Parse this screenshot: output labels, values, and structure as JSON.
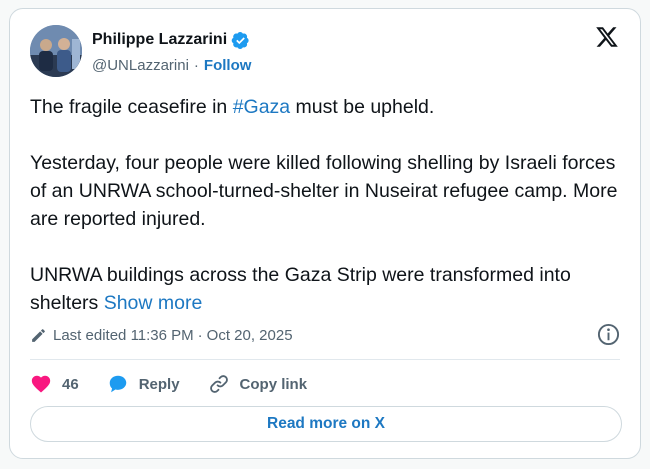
{
  "author": {
    "name": "Philippe Lazzarini",
    "handle": "@UNLazzarini",
    "separator": "·",
    "follow_label": "Follow"
  },
  "tweet": {
    "p1_before": "The fragile ceasefire in ",
    "p1_hashtag": "#Gaza",
    "p1_after": " must be upheld.",
    "p2": "Yesterday, four people were killed following shelling by Israeli forces of an UNRWA school-turned-shelter in Nuseirat refugee camp. More are reported injured.",
    "p3": "UNRWA buildings across the Gaza Strip were transformed into shelters",
    "show_more": "Show more"
  },
  "meta": {
    "edited_label": "Last edited",
    "time": "11:36 PM",
    "separator": "·",
    "date": "Oct 20, 2025"
  },
  "actions": {
    "like_count": "46",
    "reply_label": "Reply",
    "copy_link_label": "Copy link"
  },
  "read_more_label": "Read more on X",
  "icons": {
    "verified": "verified-badge-icon",
    "x_logo": "x-logo-icon",
    "pencil": "pencil-icon",
    "info": "info-icon",
    "heart": "heart-icon",
    "reply": "speech-bubble-icon",
    "link": "link-icon"
  },
  "colors": {
    "link": "#1d78c2",
    "heart": "#f91880",
    "verified": "#1d9bf0",
    "muted_text": "#536471",
    "border": "#cfd9de"
  }
}
